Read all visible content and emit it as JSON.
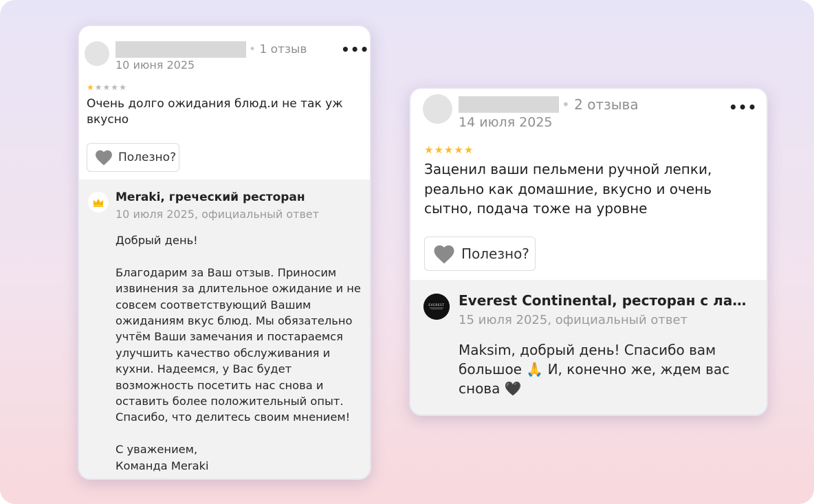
{
  "colors": {
    "star_filled": "#fcbd2b",
    "star_empty": "#b9b9b9",
    "crown": "#f7b500",
    "heart": "#8a8a8a",
    "reply_background": "#f2f2f2"
  },
  "reviews": [
    {
      "meta": "1 отзыв",
      "date": "10 июня 2025",
      "rating": 1,
      "rating_max": 5,
      "text": "Очень долго ожидания блюд.и не так уж вкусно",
      "helpful_label": "Полезно?",
      "reply": {
        "avatar_icon": "crown-icon",
        "name": "Meraki, греческий ресторан",
        "date": "10 июля 2025, официальный ответ",
        "text": "Добрый день!\n\nБлагодарим за Ваш отзыв. Приносим извинения за длительное ожидание и не совсем соответствующий Вашим ожиданиям вкус блюд. Мы обязательно учтём Ваши замечания и постараемся улучшить качество обслуживания и кухни. Надеемся, у Вас будет возможность посетить нас снова и оставить более положительный опыт. Спасибо, что делитесь своим мнением!\n\nС уважением,\nКоманда Meraki"
      }
    },
    {
      "meta": "2 отзыва",
      "date": "14 июля 2025",
      "rating": 5,
      "rating_max": 5,
      "text": "Заценил ваши пельмени ручной лепки, реально как домашние, вкусно и очень сытно, подача тоже на уровне",
      "helpful_label": "Полезно?",
      "reply": {
        "avatar_icon": "everest-logo",
        "avatar_text": "EVEREST",
        "name": "Everest Continental, ресторан с лаунд…",
        "date": "15 июля 2025, официальный ответ",
        "text": "Maksim, добрый день! Спасибо вам большое 🙏 И, конечно же, ждем вас снова 🖤"
      }
    }
  ]
}
